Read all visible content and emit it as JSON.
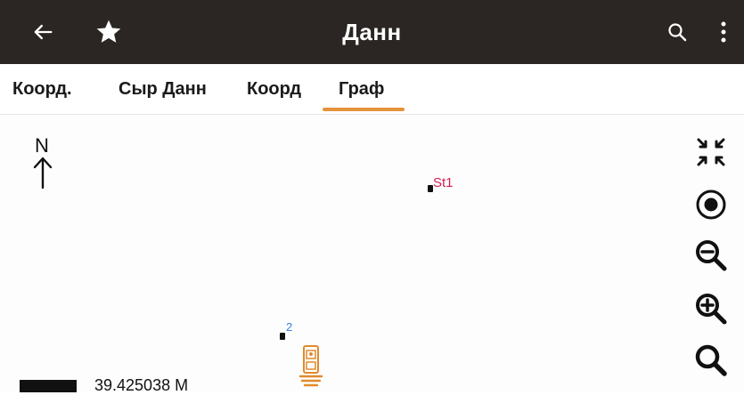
{
  "header": {
    "title": "Данн",
    "back_icon": "arrow-back-icon",
    "favorite_icon": "star-icon",
    "search_icon": "search-icon",
    "more_icon": "more-vertical-icon"
  },
  "tabs": [
    {
      "label": "Коорд."
    },
    {
      "label": "Сыр Данн"
    },
    {
      "label": "Коорд"
    },
    {
      "label": "Граф",
      "selected": true
    }
  ],
  "map": {
    "north_label": "N",
    "points": [
      {
        "label": "St1",
        "color": "#d22050"
      },
      {
        "label": "2",
        "color": "#3a7be0"
      }
    ],
    "scale_text": "39.425038 M",
    "controls": [
      "collapse-icon",
      "locate-icon",
      "zoom-out-icon",
      "zoom-in-icon",
      "search-icon"
    ]
  },
  "colors": {
    "header_bg": "#2b2523",
    "accent": "#e6923a",
    "instrument": "#e08a2c"
  }
}
